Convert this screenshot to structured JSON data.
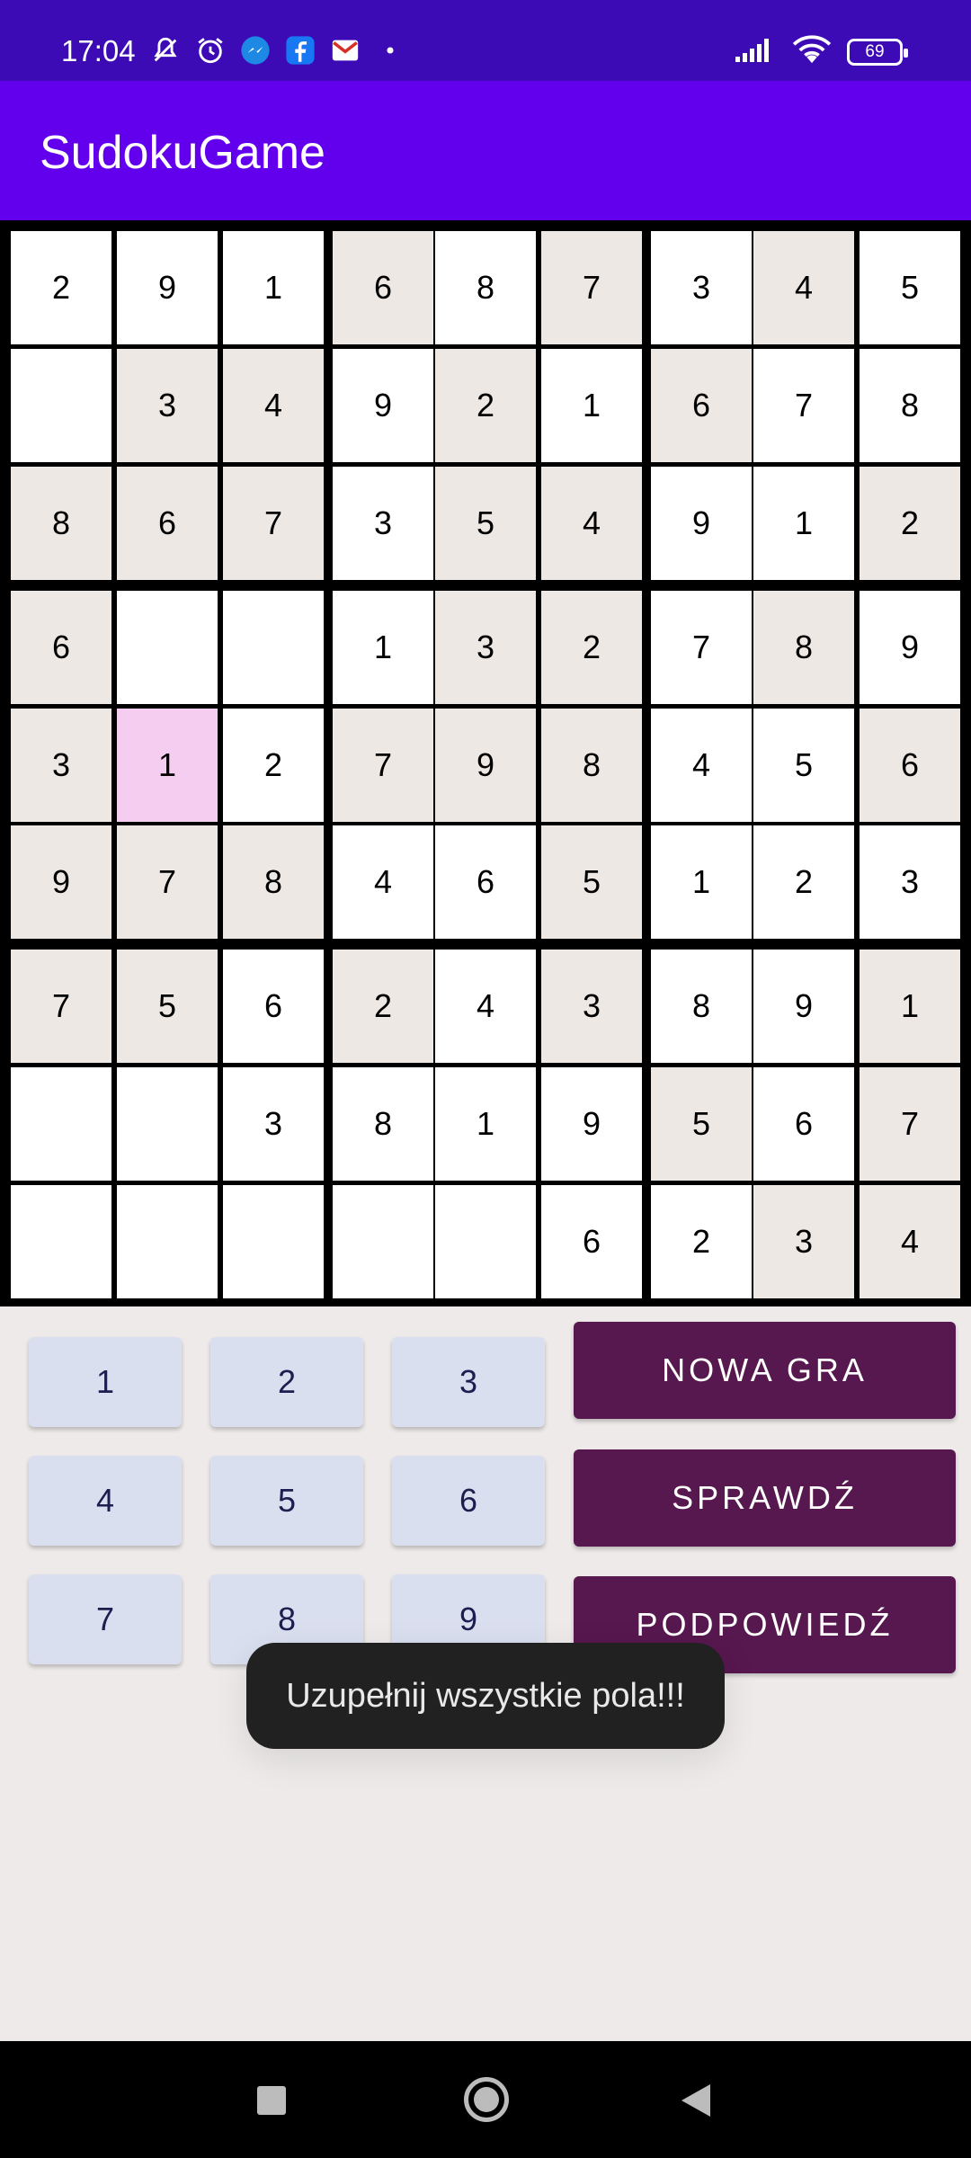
{
  "status_bar": {
    "time": "17:04",
    "battery": "69",
    "left_icons": [
      "mute-icon",
      "alarm-icon",
      "messenger-icon",
      "facebook-icon",
      "gmail-icon",
      "dot-icon"
    ],
    "right_icons": [
      "signal-icon",
      "wifi-icon",
      "battery-icon"
    ]
  },
  "app_bar": {
    "title": "SudokuGame"
  },
  "board": {
    "rows": [
      [
        "2",
        "9",
        "1",
        "6",
        "8",
        "7",
        "3",
        "4",
        "5"
      ],
      [
        "",
        "3",
        "4",
        "9",
        "2",
        "1",
        "6",
        "7",
        "8"
      ],
      [
        "8",
        "6",
        "7",
        "3",
        "5",
        "4",
        "9",
        "1",
        "2"
      ],
      [
        "6",
        "",
        "",
        "1",
        "3",
        "2",
        "7",
        "8",
        "9"
      ],
      [
        "3",
        "1",
        "2",
        "7",
        "9",
        "8",
        "4",
        "5",
        "6"
      ],
      [
        "9",
        "7",
        "8",
        "4",
        "6",
        "5",
        "1",
        "2",
        "3"
      ],
      [
        "7",
        "5",
        "6",
        "2",
        "4",
        "3",
        "8",
        "9",
        "1"
      ],
      [
        "",
        "",
        "3",
        "8",
        "1",
        "9",
        "5",
        "6",
        "7"
      ],
      [
        "",
        "",
        "",
        "",
        "",
        "6",
        "2",
        "3",
        "4"
      ]
    ],
    "shading": [
      "wwwgwgwgw",
      "wggwgwgww",
      "gggwggwwg",
      "gwwwggwgw",
      "gswgggwwg",
      "gggwwgwww",
      "ggwgwgwwg",
      "wwwwwwgwg",
      "wwwwwwwgg"
    ],
    "selected": {
      "row": 5,
      "col": 2
    }
  },
  "numpad": [
    "1",
    "2",
    "3",
    "4",
    "5",
    "6",
    "7",
    "8",
    "9"
  ],
  "actions": {
    "new_game": "NOWA GRA",
    "check": "SPRAWDŹ",
    "hint": "PODPOWIEDŹ"
  },
  "toast": {
    "message": "Uzupełnij wszystkie pola!!!"
  },
  "colors": {
    "status_bar": "#3d0bb5",
    "app_bar": "#6200ee",
    "action_button": "#57174f",
    "numpad_button": "#dadfef",
    "cell_gray": "#eee8e5",
    "cell_selected": "#f5cdf0"
  }
}
